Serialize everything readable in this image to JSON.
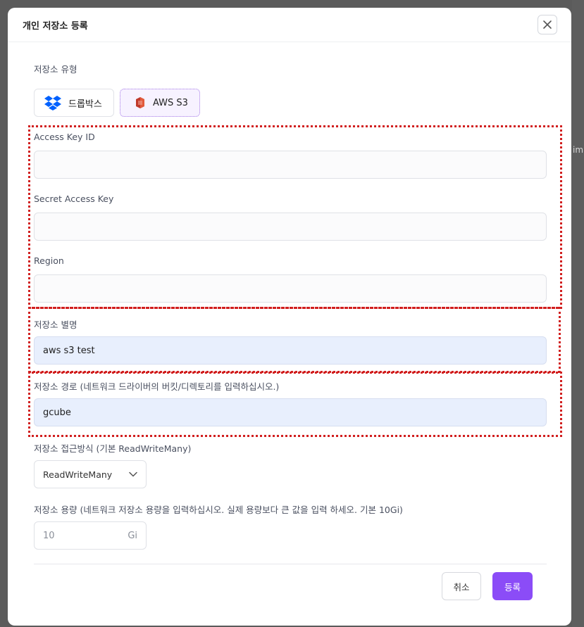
{
  "backdrop": {
    "hint": "im"
  },
  "modal": {
    "title": "개인 저장소 등록",
    "close_icon": "close-icon"
  },
  "storage_type": {
    "label": "저장소 유형",
    "options": [
      {
        "label": "드롭박스",
        "icon": "dropbox-icon"
      },
      {
        "label": "AWS S3",
        "icon": "aws-s3-icon",
        "selected": true
      }
    ]
  },
  "fields": {
    "access_key_id": {
      "label": "Access Key ID",
      "value": ""
    },
    "secret_access_key": {
      "label": "Secret Access Key",
      "value": ""
    },
    "region": {
      "label": "Region",
      "value": ""
    },
    "alias": {
      "label": "저장소 별명",
      "value": "aws s3 test"
    },
    "path": {
      "label": "저장소 경로 (네트워크 드라이버의 버킷/디렉토리를 입력하십시오.)",
      "value": "gcube"
    },
    "access_mode": {
      "label": "저장소 접근방식 (기본 ReadWriteMany)",
      "selected": "ReadWriteMany"
    },
    "capacity": {
      "label": "저장소 용량 (네트워크 저장소 용량을 입력하십시오. 실제 용량보다 큰 값을 입력 하세오. 기본 10Gi)",
      "value": "10",
      "unit": "Gi"
    }
  },
  "buttons": {
    "cancel": "취소",
    "submit": "등록"
  },
  "colors": {
    "accent": "#8b4cf7",
    "highlight_border": "#d11f1f",
    "filled_input_bg": "#e8effd"
  }
}
